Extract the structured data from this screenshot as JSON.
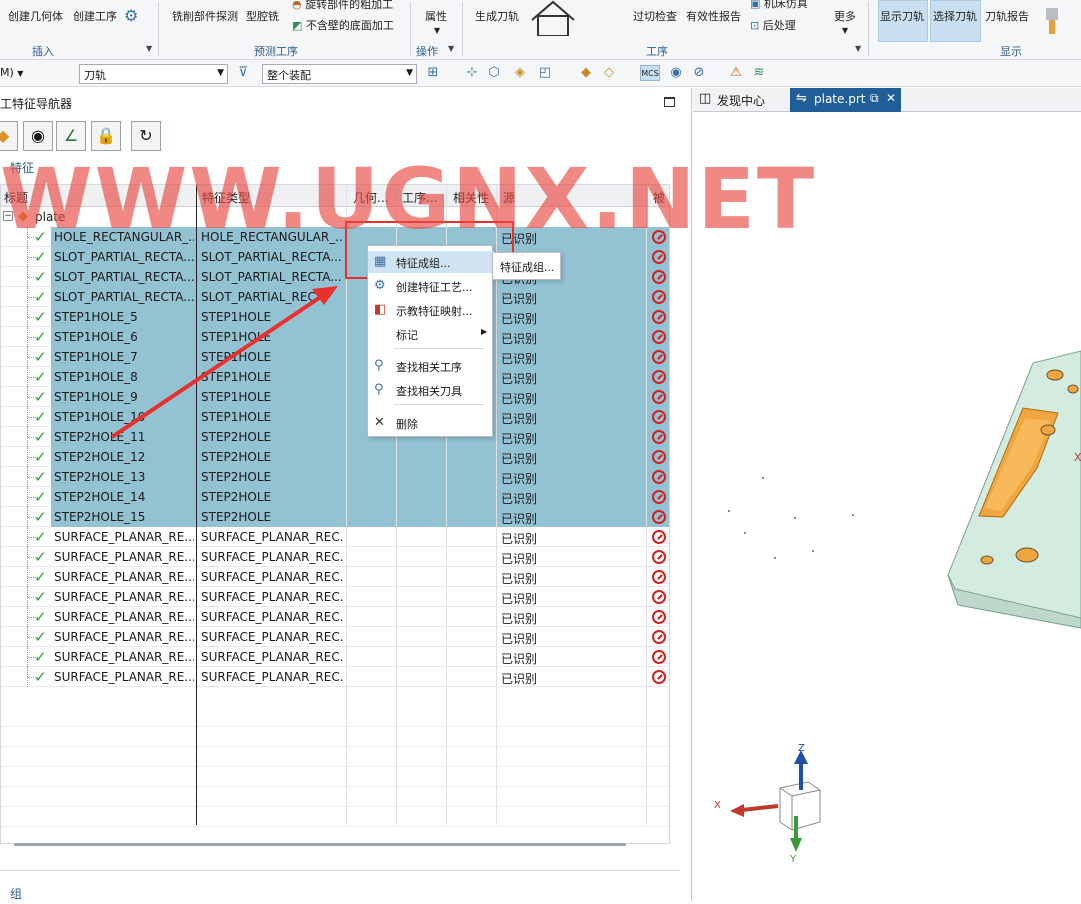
{
  "ribbon": {
    "buttons": {
      "create_geometry": "创建几何体",
      "create_operation": "创建工序",
      "milling_part_probe": "铣削部件探测",
      "cavity_mill": "型腔铣",
      "rotate_part_rough": "旋转部件的粗加工",
      "no_wall_floor": "不含壁的底面加工",
      "attributes": "属性",
      "generate_toolpath": "生成刀轨",
      "overcut_check": "过切检查",
      "validity_report": "有效性报告",
      "machine_sim": "机床仿真",
      "postprocess": "后处理",
      "more": "更多",
      "show_toolpath": "显示刀轨",
      "select_toolpath": "选择刀轨",
      "toolpath_report": "刀轨报告"
    },
    "groups": {
      "insert": "插入",
      "predict": "预测工序",
      "operate": "操作",
      "operation": "工序",
      "display": "显示"
    }
  },
  "toolbar": {
    "left_combo": "M)",
    "filter_combo": "刀轨",
    "scope_combo": "整个装配"
  },
  "navigator": {
    "title": "工特征导航器",
    "section": "特征",
    "columns": [
      "标题",
      "特征类型",
      "几何...",
      "工序...",
      "相关性",
      "源",
      "被"
    ],
    "root_label": "plate",
    "rows": [
      {
        "title": "HOLE_RECTANGULAR_...",
        "type": "HOLE_RECTANGULAR_...",
        "source": "已识别"
      },
      {
        "title": "SLOT_PARTIAL_RECTA...",
        "type": "SLOT_PARTIAL_RECTA...",
        "source": "已识别"
      },
      {
        "title": "SLOT_PARTIAL_RECTA...",
        "type": "SLOT_PARTIAL_RECTA...",
        "source": "已识别"
      },
      {
        "title": "SLOT_PARTIAL_RECTA...",
        "type": "SLOT_PARTIAL_REC...",
        "source": "已识别"
      },
      {
        "title": "STEP1HOLE_5",
        "type": "STEP1HOLE",
        "source": "已识别"
      },
      {
        "title": "STEP1HOLE_6",
        "type": "STEP1HOLE",
        "source": "已识别"
      },
      {
        "title": "STEP1HOLE_7",
        "type": "STEP1HOLE",
        "source": "已识别"
      },
      {
        "title": "STEP1HOLE_8",
        "type": "STEP1HOLE",
        "source": "已识别"
      },
      {
        "title": "STEP1HOLE_9",
        "type": "STEP1HOLE",
        "source": "已识别"
      },
      {
        "title": "STEP1HOLE_10",
        "type": "STEP1HOLE",
        "source": "已识别"
      },
      {
        "title": "STEP2HOLE_11",
        "type": "STEP2HOLE",
        "source": "已识别"
      },
      {
        "title": "STEP2HOLE_12",
        "type": "STEP2HOLE",
        "source": "已识别"
      },
      {
        "title": "STEP2HOLE_13",
        "type": "STEP2HOLE",
        "source": "已识别"
      },
      {
        "title": "STEP2HOLE_14",
        "type": "STEP2HOLE",
        "source": "已识别"
      },
      {
        "title": "STEP2HOLE_15",
        "type": "STEP2HOLE",
        "source": "已识别"
      },
      {
        "title": "SURFACE_PLANAR_RE...",
        "type": "SURFACE_PLANAR_REC...",
        "source": "已识别"
      },
      {
        "title": "SURFACE_PLANAR_RE...",
        "type": "SURFACE_PLANAR_REC...",
        "source": "已识别"
      },
      {
        "title": "SURFACE_PLANAR_RE...",
        "type": "SURFACE_PLANAR_REC...",
        "source": "已识别"
      },
      {
        "title": "SURFACE_PLANAR_RE...",
        "type": "SURFACE_PLANAR_REC...",
        "source": "已识别"
      },
      {
        "title": "SURFACE_PLANAR_RE...",
        "type": "SURFACE_PLANAR_REC...",
        "source": "已识别"
      },
      {
        "title": "SURFACE_PLANAR_RE...",
        "type": "SURFACE_PLANAR_REC...",
        "source": "已识别"
      },
      {
        "title": "SURFACE_PLANAR_RE...",
        "type": "SURFACE_PLANAR_REC...",
        "source": "已识别"
      },
      {
        "title": "SURFACE_PLANAR_RE...",
        "type": "SURFACE_PLANAR_REC...",
        "source": "已识别"
      }
    ],
    "selected_rows": 15,
    "bottom_label": "组"
  },
  "context_menu": {
    "items": [
      "特征成组...",
      "创建特征工艺...",
      "示教特征映射...",
      "标记",
      "查找相关工序",
      "查找相关刀具",
      "删除"
    ],
    "submenu": "特征成组..."
  },
  "right_tabs": {
    "discover": "发现中心",
    "file": "plate.prt"
  },
  "triad": {
    "z": "Z",
    "x": "X",
    "y": "Y"
  },
  "watermark": "WWW.UGNX.NET",
  "colors": {
    "selection": "#93c2d3",
    "accent_tab": "#1f5e96",
    "highlight_box": "#e8302e",
    "part_face": "#f0a640",
    "part_body": "#d4ece0"
  }
}
